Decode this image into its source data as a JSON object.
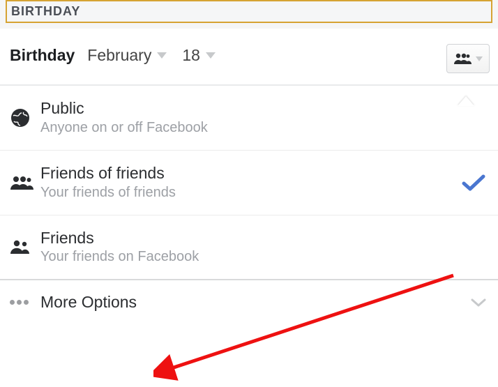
{
  "header": {
    "title": "BIRTHDAY"
  },
  "birthday": {
    "label": "Birthday",
    "month": "February",
    "day": "18"
  },
  "audience_options": [
    {
      "icon": "globe-icon",
      "title": "Public",
      "subtitle": "Anyone on or off Facebook",
      "selected": false
    },
    {
      "icon": "friends-of-friends-icon",
      "title": "Friends of friends",
      "subtitle": "Your friends of friends",
      "selected": true
    },
    {
      "icon": "friends-icon",
      "title": "Friends",
      "subtitle": "Your friends on Facebook",
      "selected": false
    }
  ],
  "more": {
    "label": "More Options"
  }
}
